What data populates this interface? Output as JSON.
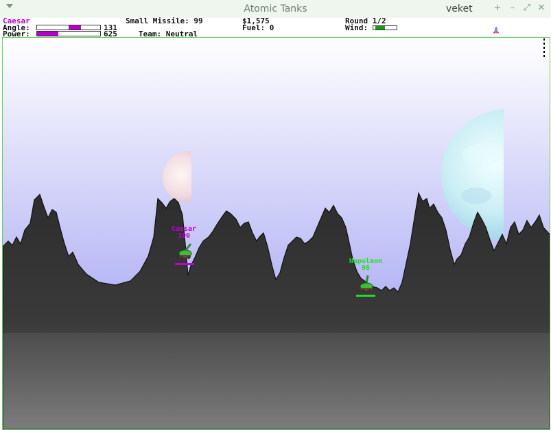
{
  "window": {
    "title": "Atomic Tanks",
    "user": "veket",
    "buttons": {
      "plus": "+",
      "minimize": "–",
      "maximize": "⤢",
      "close": "✕"
    }
  },
  "hud": {
    "player_name": "Caesar",
    "angle_label": "Angle:",
    "angle_value": "131",
    "power_label": "Power:",
    "power_value": "625",
    "weapon": "Small Missile: 99",
    "team": "Team: Neutral",
    "money": "$1,575",
    "fuel": "Fuel: 0",
    "round": "Round 1/2",
    "wind_label": "Wind:",
    "angle_bar_level": 0.5,
    "power_bar_level": 0.34,
    "player_color": "#b400c8"
  },
  "tanks": [
    {
      "name": "Caesar",
      "health": "100",
      "color": "#c000d0"
    },
    {
      "name": "Napoleon",
      "health": "98",
      "color": "#22dd22"
    }
  ],
  "colors": {
    "sky_top": "#ffffff",
    "sky_bottom": "#8f8ff0",
    "terrain_top": "#2a2a2a",
    "terrain_bottom": "#7a7a7a",
    "frame": "#5fd35f"
  }
}
